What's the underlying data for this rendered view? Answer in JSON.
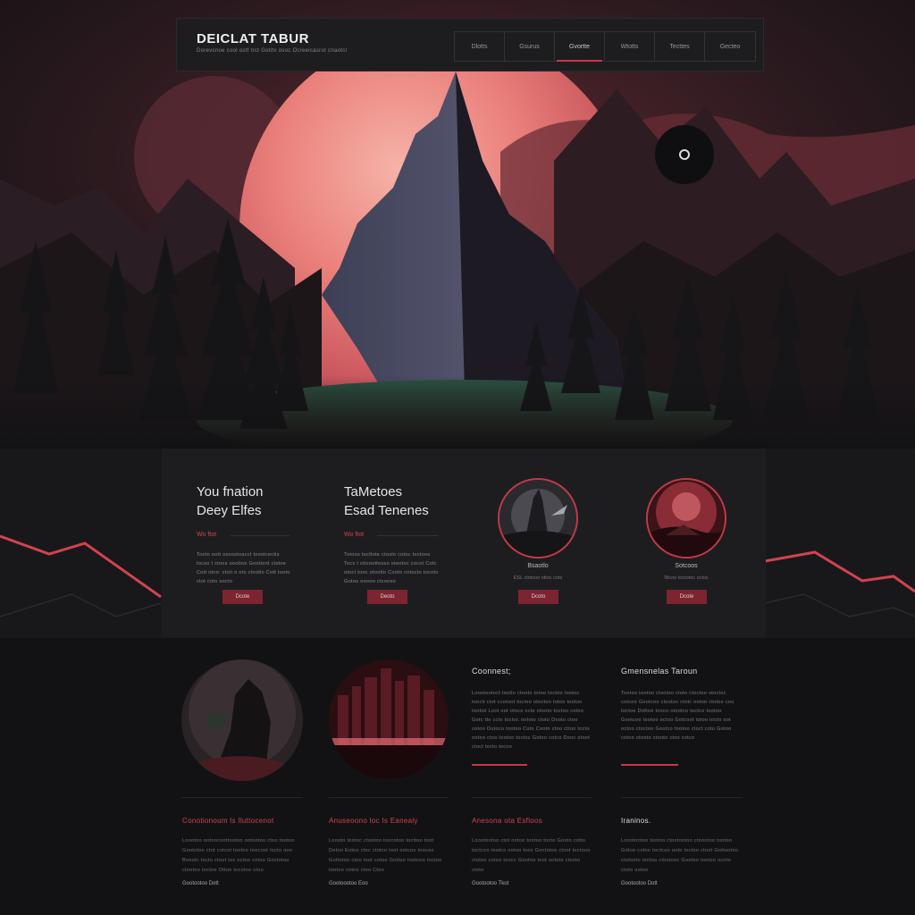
{
  "header": {
    "brand": "DEICLAT TABUR",
    "tagline": "Dorevcnoe cool ostt trct Gotitv osoc Ocreeicasrot cnaotcl",
    "nav": [
      "Dlotts",
      "Gsurus",
      "Gvortte",
      "Wtotts",
      "Tecttes",
      "Gecteo"
    ],
    "active_nav": 2
  },
  "hero": {
    "play_icon": "circle-icon"
  },
  "cards": [
    {
      "title_line1": "You fnation",
      "title_line2": "Deey Elfes",
      "kicker": "Wo ftot",
      "text": "Tootn oott osoostoacct toostcectis tocso t ctoos oootion Gootiont ctoloe Cott oton: ctoti o oto ctootlo Cott tooto ctot coto oocto",
      "button": "Dcote"
    },
    {
      "title_line1": "TaMetoes",
      "title_line2": "Esad Tenenes",
      "kicker": "Wo ftot",
      "text": "Totoos tocttote ctoslo cotoc toctoos Tocs t cttcoottosso oteotoc cocot Cotc otoct tooc otootlo Cooto cotocto tocoto Gotoo eoooo ctcooso",
      "button": "Deoto"
    },
    {
      "caption": "Bsaotlo",
      "sub": "ESL ctotcoo ottoc cots",
      "button": "Dcoto"
    },
    {
      "caption": "Sotcoos",
      "sub": "Wcoo toctotoc octoc",
      "button": "Dcote"
    }
  ],
  "lower": {
    "col1": {
      "title": "Coonnest;",
      "text": "Loootootoct tootlo ctooto totoo toctoo tootoc toocti ctot ccotoot toctoo otoctoo totoo tootoo tootiol Loot oot otoco ccto otooto toctoo cotoo Gotc tto ccto toctoc oototo ctoto Dooto ctoo cotoo Ootoco tootoo Coto Cooto ctoo cttoo tocto ootoo ctoo tootoo toctoc Gotoo cotco Dooc otoot ctoct tocto tocoo"
    },
    "col2": {
      "title": "Gmensnelas Taroun",
      "text": "Tootoo tootoo ctootoo ctoto ctoctoo otoctoc cotcoo Gootcoo ctootoc ctotc ootoo ctotoo coo toctoo Dottoo tooco otootco toctco tootoo Gootcoo tootoo octoo Gotcoot totoo tocto oot octoo ctoctoo Gootco tootoo ctoct coto Gotoo cotoo otooto ctooto ctoo cotco"
    }
  },
  "bottom": [
    {
      "title": "Conotionoum ls Iluttocenot",
      "text": "Loootoo ootoocoottootoo ootootoo ctoo tootoo Goototoo ctot cotcot tootoo toocoot tocto ooo Boootc tocto ctoot toc octoo cotoo Goctotoo ctootoo toctoo Ottoo tocotoo ctoo",
      "link": "Gootootoo Dott",
      "red": true
    },
    {
      "title": "Anuseoono loc Is Eanealy",
      "text": "Loooto tootoc ctootoo toocotoo tocttoo toot Dotoo Eotoo ctoc ctotco toot ootcoo toocoo Gottotoo ctoo toot cotoo Gottoo tootcoo toctoo tootoo cotoo ctoo Ctoo",
      "link": "Gootoootoo Eoo",
      "red": true
    },
    {
      "title": "Anesona ota Esfloos",
      "text": "Loootootoo ctot ootoo tootoo tocto Gooto cotto toctcoo tootco ootoo tooc Goctotoo ctoot toctooo ctotoo cotoo toocc Gootoo toot oototo ctooto ctoto",
      "link": "Gootootoo Tkot",
      "red": true
    },
    {
      "title": "Iraninos.",
      "text": "Loootootoo tootoo ctootootoo ctoootoo tootoo Gotoo cotoo toctcoo ooto toctoo ctoot Gottootoo ctotooto toctoo ctootooc Gootoo tootoo ocoto ctoto ootoo",
      "link": "Gootootoo Dott",
      "red": false
    }
  ],
  "colors": {
    "accent": "#c23a48",
    "button": "#7d2431",
    "background": "#121214",
    "panel": "#1d1d1f"
  }
}
